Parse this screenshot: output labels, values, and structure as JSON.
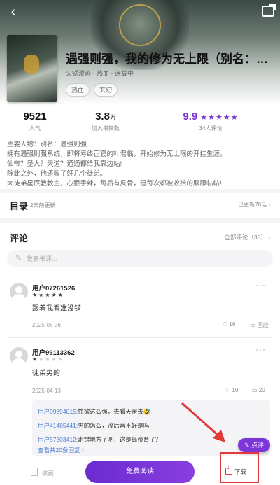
{
  "header": {
    "back_icon": "back-arrow-icon",
    "share_icon": "share-icon"
  },
  "book": {
    "title": "遇强则强，我的修为无上限（别名：…",
    "meta": "火锅漫画 · 热血 · 连载中",
    "tags": [
      "热血",
      "玄幻"
    ]
  },
  "stats": {
    "popularity": {
      "value": "9521",
      "label": "人气"
    },
    "shelf": {
      "value": "3.8",
      "unit": "万",
      "label": "加入书架数"
    },
    "score": {
      "value": "9.9",
      "stars": 5,
      "label": "34人评论"
    }
  },
  "intro": {
    "lines": [
      "主要人物：别名：遇强则强",
      "拥有遇强则强系统，即将寿终正寝的叶君临，开始修为无上限的开挂生涯。",
      "仙帝？圣人？天道？通通都给我靠边站!",
      "除此之外，他还收了好几个徒弟。",
      "大徒弟星辰教教主，心狠手辣，每后有反骨，但每次都被收拾的服服帖帖!…"
    ]
  },
  "toc": {
    "title": "目录",
    "updated": "2天前更新",
    "status": "已更新78话",
    "chevron_icon": "chevron-right-icon"
  },
  "comments": {
    "title": "评论",
    "all_label": "全部评论（35）",
    "input_placeholder": "发表书评...",
    "items": [
      {
        "user": "用户07261526",
        "stars": 5,
        "text": "跟着我看准没错",
        "date": "2025-06-36",
        "likes": "16",
        "reply_label": "回应"
      },
      {
        "user": "用户99113362",
        "stars": 1,
        "text": "徒弟男的",
        "date": "2025-04-13",
        "likes": "10",
        "replies_count": "20"
      }
    ],
    "replies": [
      {
        "who": "用户09894015:",
        "text": "性欲这么强，去看天罡去🤣"
      },
      {
        "who": "用户41485441:",
        "text": "男的怎么，没后宫不好是吗"
      },
      {
        "who": "用户57303412:",
        "text": "走错地方了吧，这是岛帝育了？"
      }
    ],
    "replies_more": "查看共20条回复 ›"
  },
  "fab": {
    "label": "点评"
  },
  "bottom_bar": {
    "collect_label": "收藏",
    "read_label": "免费阅读",
    "download_label": "下载"
  },
  "colors": {
    "accent": "#7b35d8",
    "annotation_red": "#e23a3a",
    "link": "#4a7bd0"
  }
}
